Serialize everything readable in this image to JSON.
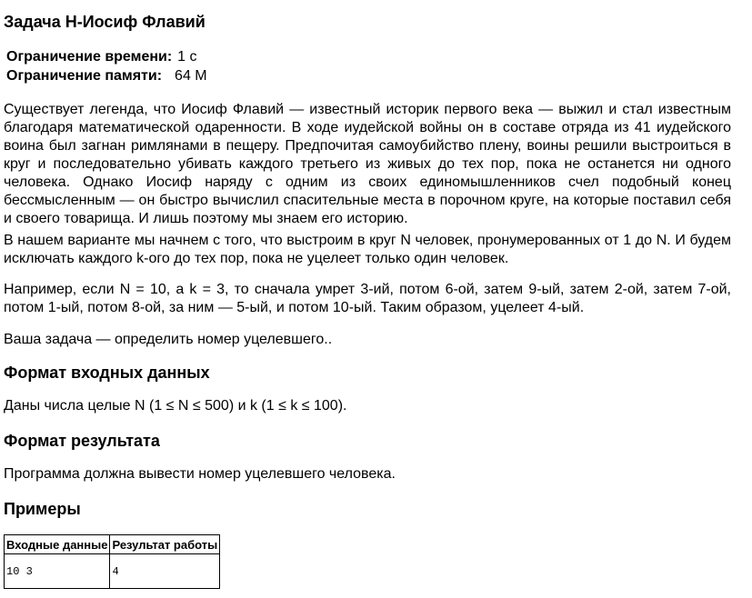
{
  "problem": {
    "title": "Задача H-Иосиф Флавий",
    "limits": {
      "time_label": "Ограничение времени:",
      "time_value": "1 с",
      "memory_label": "Ограничение памяти:",
      "memory_value": "64 M"
    },
    "statement": {
      "p1": "Существует легенда, что Иосиф Флавий — известный историк первого века — выжил и стал известным благодаря математической одаренности. В ходе иудейской войны он в составе отряда из 41 иудейского воина был загнан римлянами в пещеру. Предпочитая самоубийство плену, воины решили выстроиться в круг и последовательно убивать каждого третьего из живых до тех пор, пока не останется ни одного человека. Однако Иосиф наряду с одним из своих единомышленников счел подобный конец бессмысленным — он быстро вычислил спасительные места в порочном круге, на которые поставил себя и своего товарища. И лишь поэтому мы знаем его историю.",
      "p2": "В нашем варианте мы начнем с того, что выстроим в круг N человек, пронумерованных от 1 до N. И будем исключать каждого k-ого до тех пор, пока не уцелеет только один человек.",
      "p3": "Например, если N = 10, а k = 3, то сначала умрет 3-ий, потом 6-ой, затем 9-ый, затем 2-ой, затем 7-ой, потом 1-ый, потом 8-ой, за ним — 5-ый, и потом 10-ый. Таким образом, уцелеет 4-ый.",
      "p4": "Ваша задача — определить номер уцелевшего.."
    },
    "input_section": {
      "heading": "Формат входных данных",
      "text": "Даны числа целые N (1 ≤ N ≤ 500) и k (1 ≤ k ≤ 100)."
    },
    "output_section": {
      "heading": "Формат результата",
      "text": "Программа должна вывести номер уцелевшего человека."
    },
    "examples": {
      "heading": "Примеры",
      "columns": [
        "Входные данные",
        "Результат работы"
      ],
      "rows": [
        {
          "input": "10 3",
          "output": "4"
        }
      ]
    }
  }
}
